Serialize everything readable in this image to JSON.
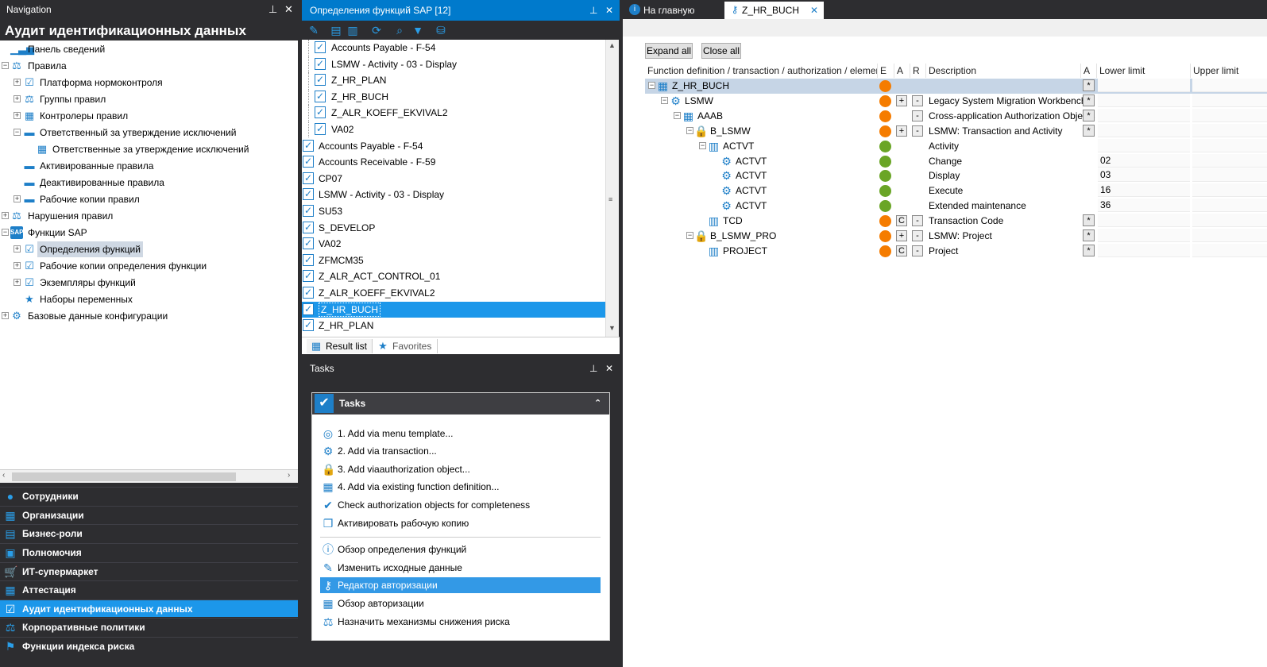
{
  "nav": {
    "header": "Navigation",
    "title": "Аудит идентификационных данных",
    "tree": [
      {
        "label": "Панель сведений",
        "icon": "bar-chart-icon"
      },
      {
        "label": "Правила",
        "icon": "rules-icon"
      },
      {
        "label": "Платформа нормоконтроля",
        "icon": "checklist-icon"
      },
      {
        "label": "Группы правил",
        "icon": "rules-group-icon"
      },
      {
        "label": "Контролеры правил",
        "icon": "grid-icon"
      },
      {
        "label": "Ответственный за утверждение исключений",
        "icon": "folder-icon"
      },
      {
        "label": "Ответственные за утверждение исключений",
        "icon": "grid-icon"
      },
      {
        "label": "Активированные правила",
        "icon": "folder-icon"
      },
      {
        "label": "Деактивированные правила",
        "icon": "folder-icon"
      },
      {
        "label": "Рабочие копии правил",
        "icon": "folder-icon"
      },
      {
        "label": "Нарушения правил",
        "icon": "violation-icon"
      },
      {
        "label": "Функции SAP",
        "icon": "sap-icon"
      },
      {
        "label": "Определения функций",
        "icon": "checklist-icon"
      },
      {
        "label": "Рабочие копии определения функции",
        "icon": "checklist-icon"
      },
      {
        "label": "Экземпляры функций",
        "icon": "checklist-icon"
      },
      {
        "label": "Наборы переменных",
        "icon": "star-icon"
      },
      {
        "label": "Базовые данные конфигурации",
        "icon": "gear-icon"
      }
    ],
    "sections": [
      {
        "label": "Сотрудники",
        "icon": "person-icon"
      },
      {
        "label": "Организации",
        "icon": "org-icon"
      },
      {
        "label": "Бизнес-роли",
        "icon": "roles-icon"
      },
      {
        "label": "Полномочия",
        "icon": "entitlement-icon"
      },
      {
        "label": "ИТ-супермаркет",
        "icon": "cart-icon"
      },
      {
        "label": "Аттестация",
        "icon": "attestation-icon"
      },
      {
        "label": "Аудит идентификационных данных",
        "icon": "audit-icon"
      },
      {
        "label": "Корпоративные политики",
        "icon": "policy-icon"
      },
      {
        "label": "Функции индекса риска",
        "icon": "risk-icon"
      }
    ]
  },
  "mid": {
    "header": "Определения функций SAP [12]",
    "list": [
      "Accounts Payable - F-54",
      "LSMW - Activity - 03 - Display",
      "Z_HR_PLAN",
      "Z_HR_BUCH",
      "Z_ALR_KOEFF_EKVIVAL2",
      "VA02",
      "Accounts Payable - F-54",
      "Accounts Receivable - F-59",
      "CP07",
      "LSMW - Activity - 03 - Display",
      "SU53",
      "S_DEVELOP",
      "VA02",
      "ZFMCM35",
      "Z_ALR_ACT_CONTROL_01",
      "Z_ALR_KOEFF_EKVIVAL2",
      "Z_HR_BUCH",
      "Z_HR_PLAN"
    ],
    "tab_result": "Result list",
    "tab_favorites": "Favorites"
  },
  "tasks": {
    "header": "Tasks",
    "title": "Tasks",
    "items": [
      {
        "label": "1. Add via menu template...",
        "icon": "menu-template-icon"
      },
      {
        "label": "2. Add via transaction...",
        "icon": "gear-icon"
      },
      {
        "label": "3. Add viaauthorization object...",
        "icon": "lock-icon"
      },
      {
        "label": "4. Add via existing function definition...",
        "icon": "function-icon"
      },
      {
        "label": "Check authorization objects for completeness",
        "icon": "check-icon"
      },
      {
        "label": "Активировать рабочую копию",
        "icon": "copy-icon"
      },
      {
        "label": "Обзор определения функций",
        "icon": "info-icon"
      },
      {
        "label": "Изменить исходные данные",
        "icon": "edit-icon"
      },
      {
        "label": "Редактор авторизации",
        "icon": "key-icon"
      },
      {
        "label": "Обзор авторизации",
        "icon": "table-icon"
      },
      {
        "label": "Назначить механизмы снижения риска",
        "icon": "mitigation-icon"
      }
    ]
  },
  "right": {
    "tab_home": "На главную",
    "tab_editor": "Z_HR_BUCH",
    "expand_all": "Expand all",
    "close_all": "Close all",
    "columns": [
      "Function definition / transaction / authorization / element",
      "E",
      "A",
      "R",
      "Description",
      "A",
      "Lower limit",
      "Upper limit"
    ],
    "rows": [
      {
        "name": "Z_HR_BUCH",
        "status": "orange",
        "a": "",
        "r": "",
        "desc": "",
        "star": true,
        "lower": "",
        "level": 0,
        "icon": "function-icon"
      },
      {
        "name": "LSMW",
        "status": "orange",
        "a": "+",
        "r": "-",
        "desc": "Legacy System Migration Workbench",
        "star": true,
        "lower": "",
        "level": 1,
        "icon": "gear-icon"
      },
      {
        "name": "AAAB",
        "status": "orange",
        "a": "",
        "r": "-",
        "desc": "Cross-application Authorization Objects",
        "star": true,
        "lower": "",
        "level": 2,
        "icon": "function-icon"
      },
      {
        "name": "B_LSMW",
        "status": "orange",
        "a": "+",
        "r": "-",
        "desc": "LSMW: Transaction and Activity",
        "star": true,
        "lower": "",
        "level": 3,
        "icon": "lock-icon"
      },
      {
        "name": "ACTVT",
        "status": "green",
        "a": "",
        "r": "",
        "desc": "Activity",
        "star": false,
        "lower": "",
        "level": 4,
        "icon": "field-icon"
      },
      {
        "name": "ACTVT",
        "status": "green",
        "a": "",
        "r": "",
        "desc": "Change",
        "star": false,
        "lower": "02",
        "level": 5,
        "icon": "value-icon"
      },
      {
        "name": "ACTVT",
        "status": "green",
        "a": "",
        "r": "",
        "desc": "Display",
        "star": false,
        "lower": "03",
        "level": 5,
        "icon": "value-icon"
      },
      {
        "name": "ACTVT",
        "status": "green",
        "a": "",
        "r": "",
        "desc": "Execute",
        "star": false,
        "lower": "16",
        "level": 5,
        "icon": "value-icon"
      },
      {
        "name": "ACTVT",
        "status": "green",
        "a": "",
        "r": "",
        "desc": "Extended maintenance",
        "star": false,
        "lower": "36",
        "level": 5,
        "icon": "value-icon"
      },
      {
        "name": "TCD",
        "status": "orange",
        "a": "C",
        "r": "-",
        "desc": "Transaction Code",
        "star": true,
        "lower": "",
        "level": 4,
        "icon": "field-icon"
      },
      {
        "name": "B_LSMW_PRO",
        "status": "orange",
        "a": "+",
        "r": "-",
        "desc": "LSMW: Project",
        "star": true,
        "lower": "",
        "level": 3,
        "icon": "lock-icon"
      },
      {
        "name": "PROJECT",
        "status": "orange",
        "a": "C",
        "r": "-",
        "desc": "Project",
        "star": true,
        "lower": "",
        "level": 4,
        "icon": "field-icon"
      }
    ],
    "star_label": "*",
    "colors": {
      "orange": "#f57c00",
      "green": "#6aa526"
    }
  }
}
